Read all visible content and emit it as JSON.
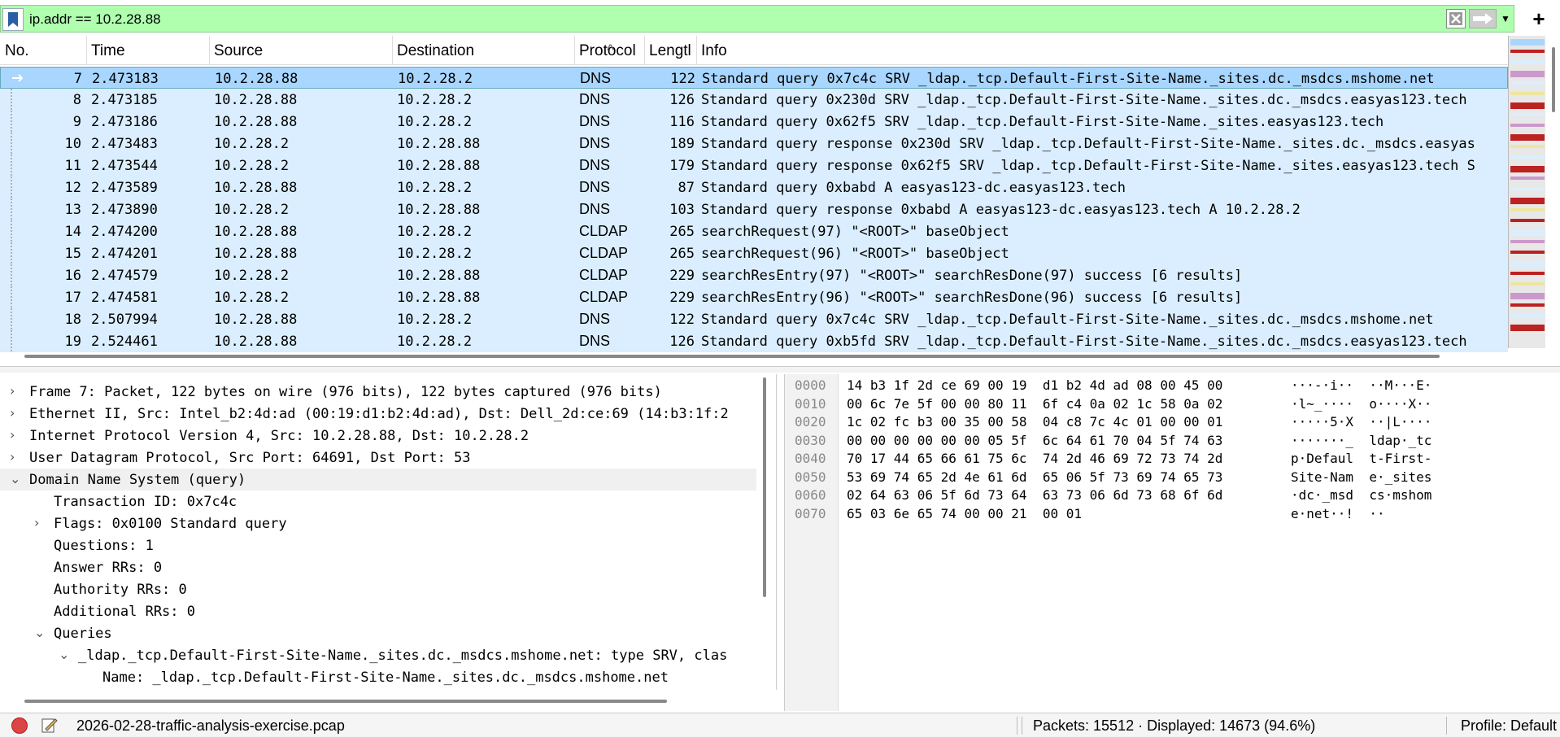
{
  "filter": {
    "value": "ip.addr == 10.2.28.88",
    "icons": [
      "bookmark-icon",
      "clear-icon",
      "apply-arrow-icon",
      "dropdown-icon",
      "plus-icon"
    ]
  },
  "packet_list": {
    "columns": [
      "No.",
      "Time",
      "Source",
      "Destination",
      "Protocol",
      "Lengtl",
      "Info"
    ],
    "rows": [
      {
        "no": "7",
        "time": "2.473183",
        "src": "10.2.28.88",
        "dst": "10.2.28.2",
        "proto": "DNS",
        "len": "122",
        "info": "Standard query 0x7c4c SRV _ldap._tcp.Default-First-Site-Name._sites.dc._msdcs.mshome.net",
        "selected": true
      },
      {
        "no": "8",
        "time": "2.473185",
        "src": "10.2.28.88",
        "dst": "10.2.28.2",
        "proto": "DNS",
        "len": "126",
        "info": "Standard query 0x230d SRV _ldap._tcp.Default-First-Site-Name._sites.dc._msdcs.easyas123.tech"
      },
      {
        "no": "9",
        "time": "2.473186",
        "src": "10.2.28.88",
        "dst": "10.2.28.2",
        "proto": "DNS",
        "len": "116",
        "info": "Standard query 0x62f5 SRV _ldap._tcp.Default-First-Site-Name._sites.easyas123.tech"
      },
      {
        "no": "10",
        "time": "2.473483",
        "src": "10.2.28.2",
        "dst": "10.2.28.88",
        "proto": "DNS",
        "len": "189",
        "info": "Standard query response 0x230d SRV _ldap._tcp.Default-First-Site-Name._sites.dc._msdcs.easyas"
      },
      {
        "no": "11",
        "time": "2.473544",
        "src": "10.2.28.2",
        "dst": "10.2.28.88",
        "proto": "DNS",
        "len": "179",
        "info": "Standard query response 0x62f5 SRV _ldap._tcp.Default-First-Site-Name._sites.easyas123.tech S"
      },
      {
        "no": "12",
        "time": "2.473589",
        "src": "10.2.28.88",
        "dst": "10.2.28.2",
        "proto": "DNS",
        "len": "87",
        "info": "Standard query 0xbabd A easyas123-dc.easyas123.tech"
      },
      {
        "no": "13",
        "time": "2.473890",
        "src": "10.2.28.2",
        "dst": "10.2.28.88",
        "proto": "DNS",
        "len": "103",
        "info": "Standard query response 0xbabd A easyas123-dc.easyas123.tech A 10.2.28.2"
      },
      {
        "no": "14",
        "time": "2.474200",
        "src": "10.2.28.88",
        "dst": "10.2.28.2",
        "proto": "CLDAP",
        "len": "265",
        "info": "searchRequest(97) \"<ROOT>\" baseObject"
      },
      {
        "no": "15",
        "time": "2.474201",
        "src": "10.2.28.88",
        "dst": "10.2.28.2",
        "proto": "CLDAP",
        "len": "265",
        "info": "searchRequest(96) \"<ROOT>\" baseObject"
      },
      {
        "no": "16",
        "time": "2.474579",
        "src": "10.2.28.2",
        "dst": "10.2.28.88",
        "proto": "CLDAP",
        "len": "229",
        "info": "searchResEntry(97) \"<ROOT>\" searchResDone(97) success  [6 results]"
      },
      {
        "no": "17",
        "time": "2.474581",
        "src": "10.2.28.2",
        "dst": "10.2.28.88",
        "proto": "CLDAP",
        "len": "229",
        "info": "searchResEntry(96) \"<ROOT>\" searchResDone(96) success  [6 results]"
      },
      {
        "no": "18",
        "time": "2.507994",
        "src": "10.2.28.88",
        "dst": "10.2.28.2",
        "proto": "DNS",
        "len": "122",
        "info": "Standard query 0x7c4c SRV _ldap._tcp.Default-First-Site-Name._sites.dc._msdcs.mshome.net"
      },
      {
        "no": "19",
        "time": "2.524461",
        "src": "10.2.28.88",
        "dst": "10.2.28.2",
        "proto": "DNS",
        "len": "126",
        "info": "Standard query 0xb5fd SRV _ldap._tcp.Default-First-Site-Name._sites.dc._msdcs.easyas123.tech"
      }
    ]
  },
  "details": [
    {
      "indent": 0,
      "arrow": "›",
      "text": "Frame 7: Packet, 122 bytes on wire (976 bits), 122 bytes captured (976 bits)"
    },
    {
      "indent": 0,
      "arrow": "›",
      "text": "Ethernet II, Src: Intel_b2:4d:ad (00:19:d1:b2:4d:ad), Dst: Dell_2d:ce:69 (14:b3:1f:2"
    },
    {
      "indent": 0,
      "arrow": "›",
      "text": "Internet Protocol Version 4, Src: 10.2.28.88, Dst: 10.2.28.2"
    },
    {
      "indent": 0,
      "arrow": "›",
      "text": "User Datagram Protocol, Src Port: 64691, Dst Port: 53"
    },
    {
      "indent": 0,
      "arrow": "⌄",
      "text": "Domain Name System (query)",
      "selected": true
    },
    {
      "indent": 1,
      "arrow": "",
      "text": "Transaction ID: 0x7c4c"
    },
    {
      "indent": 1,
      "arrow": "›",
      "text": "Flags: 0x0100 Standard query"
    },
    {
      "indent": 1,
      "arrow": "",
      "text": "Questions: 1"
    },
    {
      "indent": 1,
      "arrow": "",
      "text": "Answer RRs: 0"
    },
    {
      "indent": 1,
      "arrow": "",
      "text": "Authority RRs: 0"
    },
    {
      "indent": 1,
      "arrow": "",
      "text": "Additional RRs: 0"
    },
    {
      "indent": 1,
      "arrow": "⌄",
      "text": "Queries"
    },
    {
      "indent": 2,
      "arrow": "⌄",
      "text": "_ldap._tcp.Default-First-Site-Name._sites.dc._msdcs.mshome.net: type SRV, clas"
    },
    {
      "indent": 3,
      "arrow": "",
      "text": "Name: _ldap._tcp.Default-First-Site-Name._sites.dc._msdcs.mshome.net"
    }
  ],
  "bytes": [
    {
      "off": "0000",
      "hex": "14 b3 1f 2d ce 69 00 19  d1 b2 4d ad 08 00 45 00",
      "ascii": "···-·i··  ··M···E·"
    },
    {
      "off": "0010",
      "hex": "00 6c 7e 5f 00 00 80 11  6f c4 0a 02 1c 58 0a 02",
      "ascii": "·l~_····  o····X··"
    },
    {
      "off": "0020",
      "hex": "1c 02 fc b3 00 35 00 58  04 c8 7c 4c 01 00 00 01",
      "ascii": "·····5·X  ··|L····"
    },
    {
      "off": "0030",
      "hex": "00 00 00 00 00 00 05 5f  6c 64 61 70 04 5f 74 63",
      "ascii": "·······_  ldap·_tc"
    },
    {
      "off": "0040",
      "hex": "70 17 44 65 66 61 75 6c  74 2d 46 69 72 73 74 2d",
      "ascii": "p·Defaul  t-First-"
    },
    {
      "off": "0050",
      "hex": "53 69 74 65 2d 4e 61 6d  65 06 5f 73 69 74 65 73",
      "ascii": "Site-Nam  e·_sites"
    },
    {
      "off": "0060",
      "hex": "02 64 63 06 5f 6d 73 64  63 73 06 6d 73 68 6f 6d",
      "ascii": "·dc·_msd  cs·mshom"
    },
    {
      "off": "0070",
      "hex": "65 03 6e 65 74 00 00 21  00 01",
      "ascii": "e·net··!  ··"
    }
  ],
  "status": {
    "file": "2026-02-28-traffic-analysis-exercise.pcap",
    "packets": "Packets: 15512 · Displayed: 14673 (94.6%)",
    "profile": "Profile: Default"
  }
}
